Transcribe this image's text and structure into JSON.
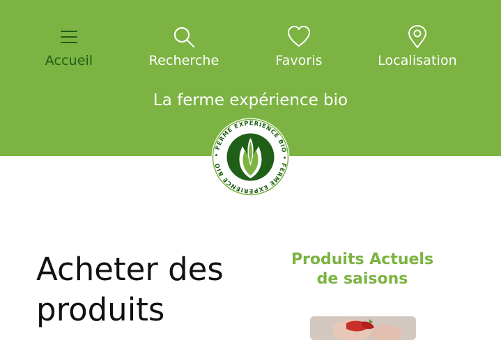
{
  "nav": {
    "items": [
      {
        "label": "Accueil",
        "icon": "menu-icon",
        "active": true
      },
      {
        "label": "Recherche",
        "icon": "search-icon",
        "active": false
      },
      {
        "label": "Favoris",
        "icon": "heart-icon",
        "active": false
      },
      {
        "label": "Localisation",
        "icon": "location-pin-icon",
        "active": false
      }
    ]
  },
  "brand": {
    "name": "La ferme expérience bio",
    "logo_text": "FERME EXPERIENCE BIO"
  },
  "main": {
    "heading_line1": "Acheter des",
    "heading_line2": "produits",
    "season_line1": "Produits Actuels",
    "season_line2": "de saisons"
  },
  "colors": {
    "primary_green": "#7cb342",
    "dark_green": "#1f5f17",
    "white": "#ffffff"
  }
}
